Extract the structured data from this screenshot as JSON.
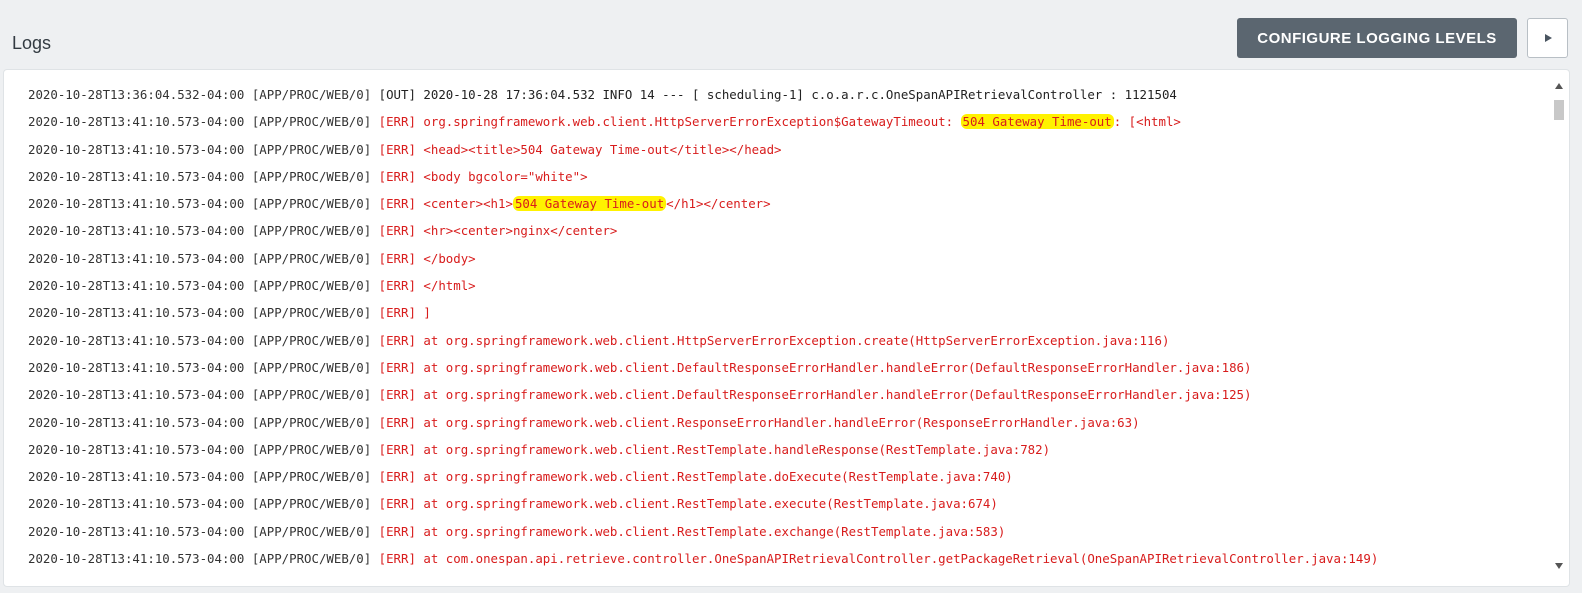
{
  "header": {
    "title": "Logs",
    "configure_label": "CONFIGURE LOGGING LEVELS"
  },
  "logs": [
    {
      "ts": "2020-10-28T13:36:04.532-04:00",
      "src": "[APP/PROC/WEB/0]",
      "tag": "[OUT]",
      "msg_pre": "2020-10-28 17:36:04.532 INFO 14 --- [ scheduling-1] c.o.a.r.c.OneSpanAPIRetrievalController : 1121504",
      "hl": "",
      "msg_post": ""
    },
    {
      "ts": "2020-10-28T13:41:10.573-04:00",
      "src": "[APP/PROC/WEB/0]",
      "tag": "[ERR]",
      "msg_pre": "org.springframework.web.client.HttpServerErrorException$GatewayTimeout: ",
      "hl": "504 Gateway Time-out",
      "msg_post": ": [<html>"
    },
    {
      "ts": "2020-10-28T13:41:10.573-04:00",
      "src": "[APP/PROC/WEB/0]",
      "tag": "[ERR]",
      "msg_pre": "<head><title>504 Gateway Time-out</title></head>",
      "hl": "",
      "msg_post": ""
    },
    {
      "ts": "2020-10-28T13:41:10.573-04:00",
      "src": "[APP/PROC/WEB/0]",
      "tag": "[ERR]",
      "msg_pre": "<body bgcolor=\"white\">",
      "hl": "",
      "msg_post": ""
    },
    {
      "ts": "2020-10-28T13:41:10.573-04:00",
      "src": "[APP/PROC/WEB/0]",
      "tag": "[ERR]",
      "msg_pre": "<center><h1>",
      "hl": "504 Gateway Time-out",
      "msg_post": "</h1></center>"
    },
    {
      "ts": "2020-10-28T13:41:10.573-04:00",
      "src": "[APP/PROC/WEB/0]",
      "tag": "[ERR]",
      "msg_pre": "<hr><center>nginx</center>",
      "hl": "",
      "msg_post": ""
    },
    {
      "ts": "2020-10-28T13:41:10.573-04:00",
      "src": "[APP/PROC/WEB/0]",
      "tag": "[ERR]",
      "msg_pre": "</body>",
      "hl": "",
      "msg_post": ""
    },
    {
      "ts": "2020-10-28T13:41:10.573-04:00",
      "src": "[APP/PROC/WEB/0]",
      "tag": "[ERR]",
      "msg_pre": "</html>",
      "hl": "",
      "msg_post": ""
    },
    {
      "ts": "2020-10-28T13:41:10.573-04:00",
      "src": "[APP/PROC/WEB/0]",
      "tag": "[ERR]",
      "msg_pre": "]",
      "hl": "",
      "msg_post": ""
    },
    {
      "ts": "2020-10-28T13:41:10.573-04:00",
      "src": "[APP/PROC/WEB/0]",
      "tag": "[ERR]",
      "msg_pre": "at org.springframework.web.client.HttpServerErrorException.create(HttpServerErrorException.java:116)",
      "hl": "",
      "msg_post": ""
    },
    {
      "ts": "2020-10-28T13:41:10.573-04:00",
      "src": "[APP/PROC/WEB/0]",
      "tag": "[ERR]",
      "msg_pre": "at org.springframework.web.client.DefaultResponseErrorHandler.handleError(DefaultResponseErrorHandler.java:186)",
      "hl": "",
      "msg_post": ""
    },
    {
      "ts": "2020-10-28T13:41:10.573-04:00",
      "src": "[APP/PROC/WEB/0]",
      "tag": "[ERR]",
      "msg_pre": "at org.springframework.web.client.DefaultResponseErrorHandler.handleError(DefaultResponseErrorHandler.java:125)",
      "hl": "",
      "msg_post": ""
    },
    {
      "ts": "2020-10-28T13:41:10.573-04:00",
      "src": "[APP/PROC/WEB/0]",
      "tag": "[ERR]",
      "msg_pre": "at org.springframework.web.client.ResponseErrorHandler.handleError(ResponseErrorHandler.java:63)",
      "hl": "",
      "msg_post": ""
    },
    {
      "ts": "2020-10-28T13:41:10.573-04:00",
      "src": "[APP/PROC/WEB/0]",
      "tag": "[ERR]",
      "msg_pre": "at org.springframework.web.client.RestTemplate.handleResponse(RestTemplate.java:782)",
      "hl": "",
      "msg_post": ""
    },
    {
      "ts": "2020-10-28T13:41:10.573-04:00",
      "src": "[APP/PROC/WEB/0]",
      "tag": "[ERR]",
      "msg_pre": "at org.springframework.web.client.RestTemplate.doExecute(RestTemplate.java:740)",
      "hl": "",
      "msg_post": ""
    },
    {
      "ts": "2020-10-28T13:41:10.573-04:00",
      "src": "[APP/PROC/WEB/0]",
      "tag": "[ERR]",
      "msg_pre": "at org.springframework.web.client.RestTemplate.execute(RestTemplate.java:674)",
      "hl": "",
      "msg_post": ""
    },
    {
      "ts": "2020-10-28T13:41:10.573-04:00",
      "src": "[APP/PROC/WEB/0]",
      "tag": "[ERR]",
      "msg_pre": "at org.springframework.web.client.RestTemplate.exchange(RestTemplate.java:583)",
      "hl": "",
      "msg_post": ""
    },
    {
      "ts": "2020-10-28T13:41:10.573-04:00",
      "src": "[APP/PROC/WEB/0]",
      "tag": "[ERR]",
      "msg_pre": "at com.onespan.api.retrieve.controller.OneSpanAPIRetrievalController.getPackageRetrieval(OneSpanAPIRetrievalController.java:149)",
      "hl": "",
      "msg_post": ""
    }
  ],
  "colors": {
    "err": "#d81c1c",
    "out": "#222222",
    "highlight": "#fff200",
    "button_bg": "#5b6670"
  },
  "icons": {
    "play": "play-icon",
    "scroll_up": "scroll-up-arrow-icon",
    "scroll_down": "scroll-down-arrow-icon"
  }
}
